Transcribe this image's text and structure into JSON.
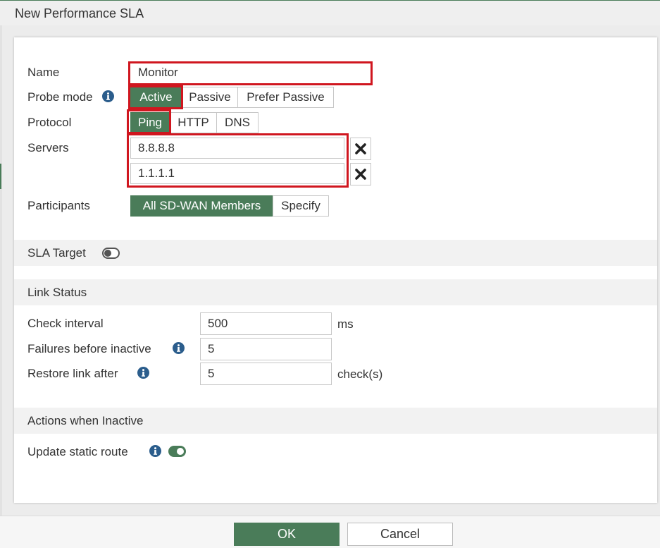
{
  "dialog": {
    "title": "New Performance SLA"
  },
  "colors": {
    "accent": "#4a7c59",
    "highlight": "#d0161f",
    "info_icon": "#2b5d8c"
  },
  "form": {
    "name": {
      "label": "Name",
      "value": "Monitor"
    },
    "probe_mode": {
      "label": "Probe mode",
      "options": [
        "Active",
        "Passive",
        "Prefer Passive"
      ],
      "selected": "Active"
    },
    "protocol": {
      "label": "Protocol",
      "options": [
        "Ping",
        "HTTP",
        "DNS"
      ],
      "selected": "Ping"
    },
    "servers": {
      "label": "Servers",
      "values": [
        "8.8.8.8",
        "1.1.1.1"
      ]
    },
    "participants": {
      "label": "Participants",
      "options": [
        "All SD-WAN Members",
        "Specify"
      ],
      "selected": "All SD-WAN Members"
    }
  },
  "sla_target": {
    "label": "SLA Target",
    "enabled": false
  },
  "link_status": {
    "title": "Link Status",
    "check_interval": {
      "label": "Check interval",
      "value": "500",
      "unit": "ms"
    },
    "failures_before_inactive": {
      "label": "Failures before inactive",
      "value": "5"
    },
    "restore_link_after": {
      "label": "Restore link after",
      "value": "5",
      "unit": "check(s)"
    }
  },
  "actions_inactive": {
    "title": "Actions when Inactive",
    "update_static_route": {
      "label": "Update static route",
      "enabled": true
    }
  },
  "footer": {
    "ok_label": "OK",
    "cancel_label": "Cancel"
  }
}
